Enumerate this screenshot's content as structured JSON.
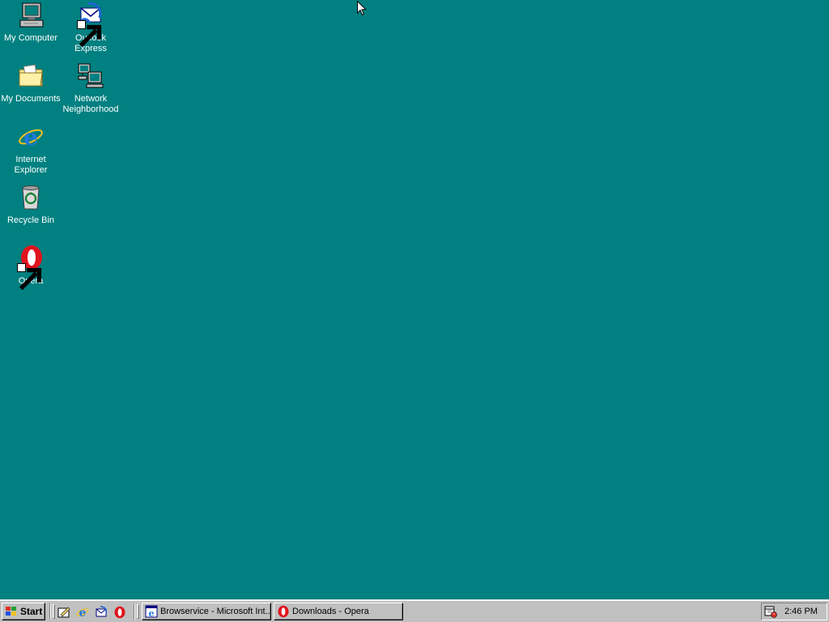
{
  "desktop": {
    "background_color": "#008080",
    "icons": [
      {
        "label": "My Computer",
        "icon": "computer-icon",
        "shortcut": false
      },
      {
        "label": "Outlook\nExpress",
        "icon": "outlook-express-icon",
        "shortcut": true
      },
      {
        "label": "My Documents",
        "icon": "folder-icon",
        "shortcut": false
      },
      {
        "label": "Network\nNeighborhood",
        "icon": "network-icon",
        "shortcut": false
      },
      {
        "label": "Internet\nExplorer",
        "icon": "internet-explorer-icon",
        "shortcut": false
      },
      {
        "label": "Recycle Bin",
        "icon": "recycle-bin-icon",
        "shortcut": false
      },
      {
        "label": "Opera",
        "icon": "opera-icon",
        "shortcut": true
      }
    ]
  },
  "taskbar": {
    "start_label": "Start",
    "quick_launch": [
      "show-desktop-icon",
      "internet-explorer-icon",
      "outlook-express-icon",
      "opera-icon"
    ],
    "tasks": [
      {
        "label": "Browservice - Microsoft Int...",
        "icon": "internet-explorer-page-icon"
      },
      {
        "label": "Downloads - Opera",
        "icon": "opera-icon"
      }
    ],
    "tray": {
      "icon": "scheduler-icon",
      "clock": "2:46 PM"
    }
  }
}
